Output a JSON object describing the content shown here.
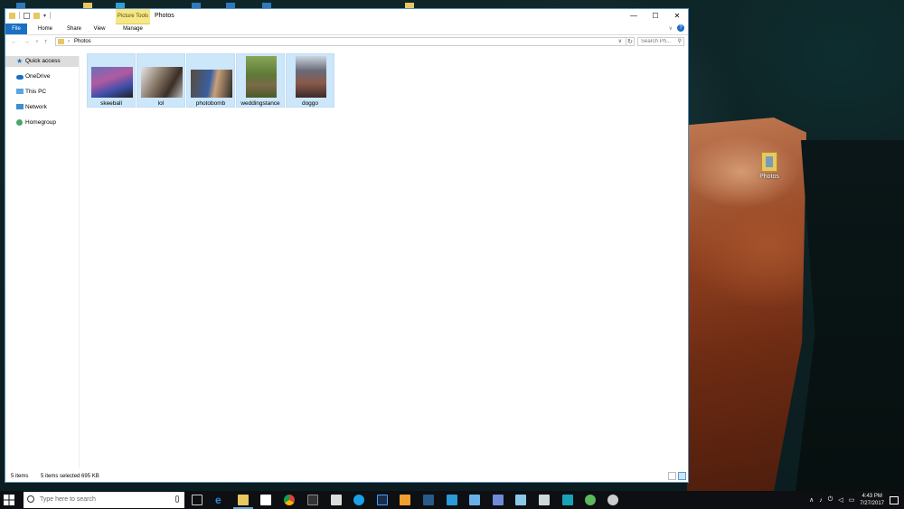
{
  "window": {
    "title": "Photos",
    "contextual_tab": "Picture Tools",
    "controls": {
      "minimize": "—",
      "maximize": "☐",
      "close": "✕"
    },
    "help": "?"
  },
  "ribbon": {
    "tabs": [
      {
        "label": "File"
      },
      {
        "label": "Home"
      },
      {
        "label": "Share"
      },
      {
        "label": "View"
      },
      {
        "label": "Manage"
      }
    ]
  },
  "address": {
    "breadcrumb": "Photos",
    "search_placeholder": "Search Ph..."
  },
  "nav_pane": {
    "items": [
      {
        "label": "Quick access",
        "icon": "star-icon"
      },
      {
        "label": "OneDrive",
        "icon": "cloud-icon"
      },
      {
        "label": "This PC",
        "icon": "computer-icon"
      },
      {
        "label": "Network",
        "icon": "network-icon"
      },
      {
        "label": "Homegroup",
        "icon": "homegroup-icon"
      }
    ]
  },
  "files": [
    {
      "name": "skeeball"
    },
    {
      "name": "lol"
    },
    {
      "name": "photobomb"
    },
    {
      "name": "weddingstance"
    },
    {
      "name": "doggo"
    }
  ],
  "status": {
    "item_count": "5 items",
    "selection": "5 items selected  695 KB"
  },
  "desktop": {
    "icon_label": "Photos"
  },
  "taskbar": {
    "search_placeholder": "Type here to search",
    "time": "4:43 PM",
    "date": "7/27/2017"
  },
  "colors": {
    "accent": "#1a6fc4",
    "selection": "#cce6fa",
    "picture_tools": "#f6e889"
  }
}
